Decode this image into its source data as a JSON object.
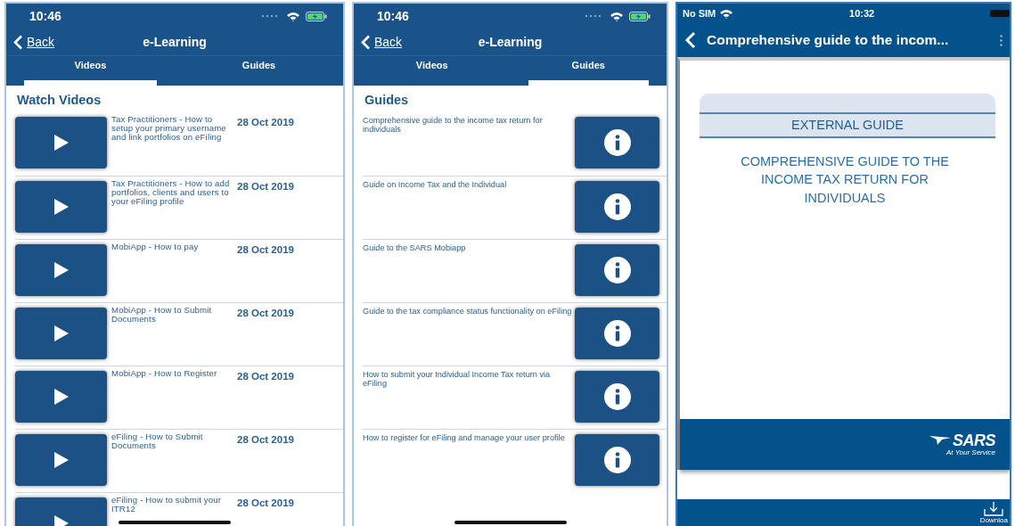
{
  "screens": [
    {
      "kind": "list",
      "status_bar": {
        "time": "10:46"
      },
      "nav": {
        "back": "Back",
        "title": "e-Learning"
      },
      "tabs": [
        {
          "label": "Videos",
          "selected": true
        },
        {
          "label": "Guides",
          "selected": false
        }
      ],
      "section_title": "Watch Videos",
      "items": [
        {
          "kind": "video",
          "title": "Tax Practitioners - How to setup your primary username and link portfolios on eFiling",
          "date": "28 Oct 2019"
        },
        {
          "kind": "video",
          "title": "Tax Practitioners - How to add portfolios, clients and users to your eFiling profile",
          "date": "28 Oct 2019"
        },
        {
          "kind": "video",
          "title": "MobiApp - How to pay",
          "date": "28 Oct 2019"
        },
        {
          "kind": "video",
          "title": "MobiApp - How to Submit Documents",
          "date": "28 Oct 2019"
        },
        {
          "kind": "video",
          "title": "MobiApp - How to Register",
          "date": "28 Oct 2019"
        },
        {
          "kind": "video",
          "title": "eFiling - How to Submit Documents",
          "date": "28 Oct 2019"
        },
        {
          "kind": "video",
          "title": "eFiling - How to submit your ITR12",
          "date": "28 Oct 2019"
        }
      ]
    },
    {
      "kind": "list",
      "status_bar": {
        "time": "10:46"
      },
      "nav": {
        "back": "Back",
        "title": "e-Learning"
      },
      "tabs": [
        {
          "label": "Videos",
          "selected": false
        },
        {
          "label": "Guides",
          "selected": true
        }
      ],
      "section_title": "Guides",
      "items": [
        {
          "kind": "guide",
          "title": "Comprehensive guide to the income tax return for individuals"
        },
        {
          "kind": "guide",
          "title": "Guide on Income Tax and the Individual"
        },
        {
          "kind": "guide",
          "title": "Guide to the SARS Mobiapp"
        },
        {
          "kind": "guide",
          "title": "Guide to the tax compliance status functionality on eFiling"
        },
        {
          "kind": "guide",
          "title": "How to submit your Individual Income Tax return via eFiling"
        },
        {
          "kind": "guide",
          "title": "How to register for eFiling and manage your user profile"
        }
      ]
    },
    {
      "kind": "document",
      "status_bar": {
        "carrier": "No SIM",
        "time": "10:32"
      },
      "nav": {
        "title": "Comprehensive guide to the incom..."
      },
      "document": {
        "banner": "EXTERNAL GUIDE",
        "heading": "COMPREHENSIVE GUIDE TO THE INCOME TAX RETURN FOR INDIVIDUALS",
        "logo_text": "SARS",
        "tagline": "At Your Service"
      },
      "toolbar": {
        "download": "Downloa"
      }
    }
  ]
}
